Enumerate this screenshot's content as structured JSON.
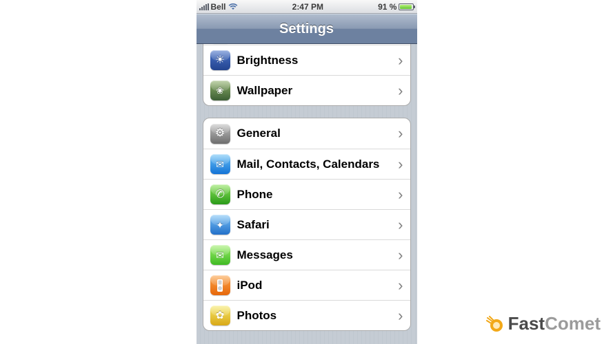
{
  "status": {
    "carrier": "Bell",
    "time": "2:47 PM",
    "battery_text": "91 %",
    "battery_pct": 91
  },
  "nav": {
    "title": "Settings"
  },
  "group1": {
    "partial_label": "",
    "brightness_label": "Brightness",
    "wallpaper_label": "Wallpaper"
  },
  "group2": {
    "general_label": "General",
    "mail_label": "Mail, Contacts, Calendars",
    "phone_label": "Phone",
    "safari_label": "Safari",
    "messages_label": "Messages",
    "ipod_label": "iPod",
    "photos_label": "Photos"
  },
  "watermark": {
    "brand_bold": "Fast",
    "brand_light": "Comet"
  }
}
